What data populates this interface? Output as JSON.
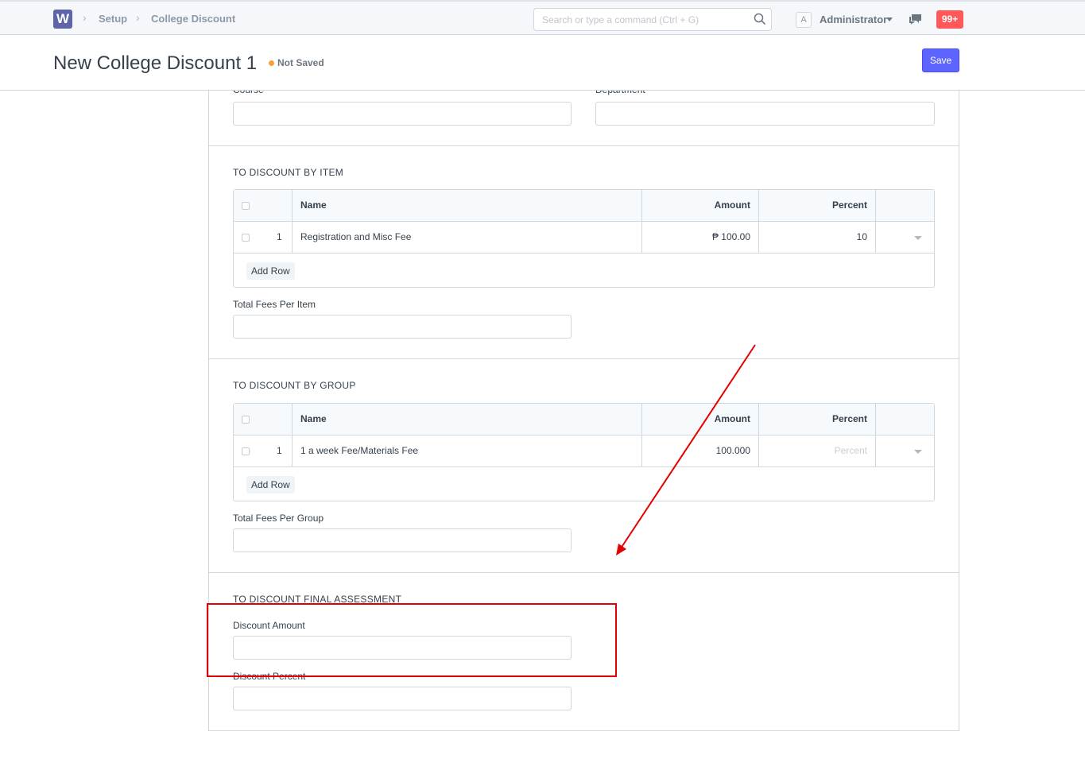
{
  "nav": {
    "logo_letter": "W",
    "breadcrumbs": [
      "Setup",
      "College Discount"
    ],
    "search_placeholder": "Search or type a command (Ctrl + G)",
    "avatar_letter": "A",
    "user_name": "Administrator",
    "notification_count": "99+"
  },
  "page": {
    "title": "New College Discount 1",
    "status": "Not Saved",
    "save_label": "Save"
  },
  "top_fields": {
    "course_label": "Course",
    "department_label": "Department"
  },
  "by_item": {
    "title": "TO DISCOUNT BY ITEM",
    "columns": {
      "name": "Name",
      "amount": "Amount",
      "percent": "Percent"
    },
    "rows": [
      {
        "idx": "1",
        "name": "Registration and Misc Fee",
        "amount": "₱ 100.00",
        "percent": "10"
      }
    ],
    "add_row": "Add Row",
    "total_label": "Total Fees Per Item"
  },
  "by_group": {
    "title": "TO DISCOUNT BY GROUP",
    "columns": {
      "name": "Name",
      "amount": "Amount",
      "percent": "Percent"
    },
    "rows": [
      {
        "idx": "1",
        "name": "1 a week Fee/Materials Fee",
        "amount": "100.000",
        "percent_placeholder": "Percent"
      }
    ],
    "add_row": "Add Row",
    "total_label": "Total Fees Per Group"
  },
  "final_assessment": {
    "title": "TO DISCOUNT FINAL ASSESSMENT",
    "amount_label": "Discount Amount",
    "percent_label": "Discount Percent"
  },
  "colors": {
    "primary": "#5e64ff",
    "annotation": "#e30000",
    "indicator": "#f8a033",
    "notification": "#ff5858"
  }
}
